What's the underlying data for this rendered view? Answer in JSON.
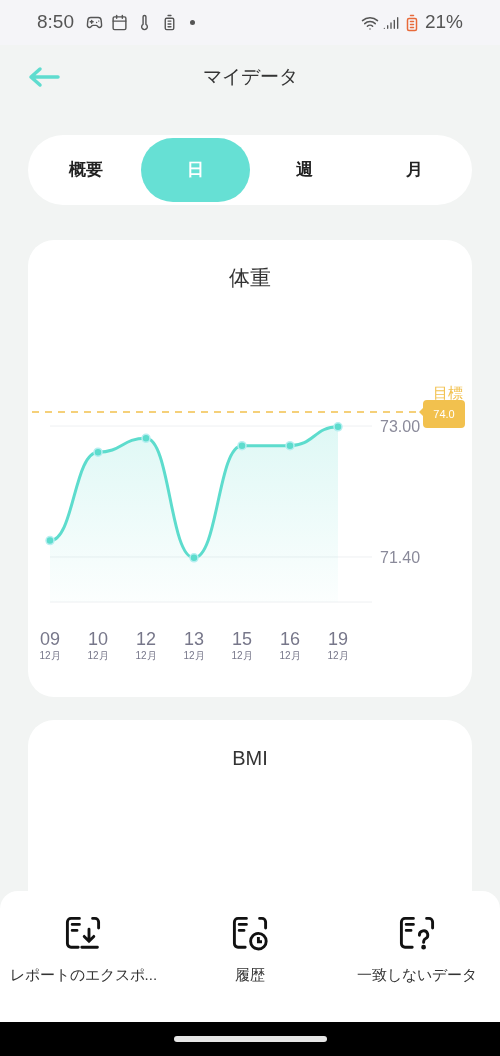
{
  "status_bar": {
    "time": "8:50",
    "battery": "21%"
  },
  "header": {
    "title": "マイデータ"
  },
  "tabs": [
    {
      "label": "概要",
      "selected": false
    },
    {
      "label": "日",
      "selected": true
    },
    {
      "label": "週",
      "selected": false
    },
    {
      "label": "月",
      "selected": false
    }
  ],
  "weight_card": {
    "goal": {
      "label": "目標",
      "value": "74.0"
    },
    "category_months": [
      "12月",
      "12月",
      "12月",
      "12月",
      "12月",
      "12月",
      "12月"
    ],
    "chart_data": {
      "type": "area",
      "title": "体重",
      "categories": [
        "09",
        "10",
        "12",
        "13",
        "15",
        "16",
        "19"
      ],
      "series": [
        {
          "color": "#5ddccd",
          "values": [
            71.6,
            72.68,
            72.85,
            71.39,
            72.76,
            72.76,
            72.99
          ]
        }
      ],
      "ylim": [
        70.85,
        73.0
      ],
      "yticks": [
        {
          "value": 71.4,
          "label": "71.40"
        },
        {
          "value": 73.0,
          "label": "73.00"
        }
      ]
    }
  },
  "bmi_card": {
    "title": "BMI"
  },
  "actions": [
    {
      "kind": "export",
      "label": "レポートのエクスポ..."
    },
    {
      "kind": "history",
      "label": "履歴"
    },
    {
      "kind": "mismatch",
      "label": "一致しないデータ"
    }
  ]
}
